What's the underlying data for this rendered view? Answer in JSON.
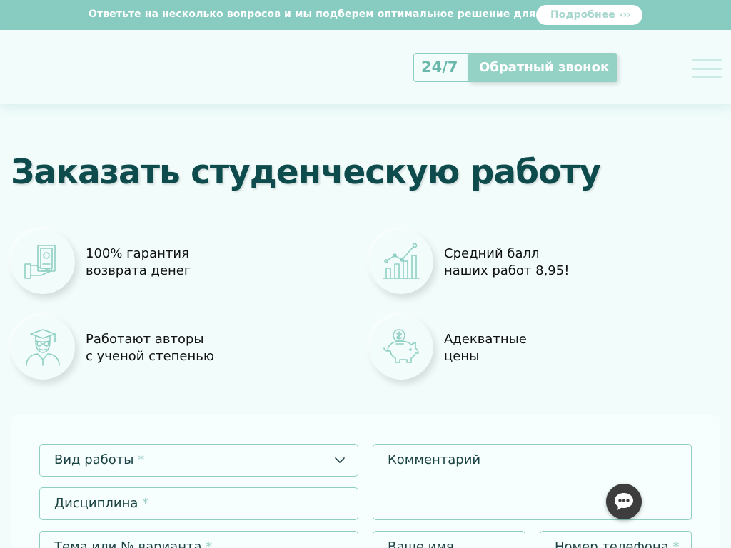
{
  "promo": {
    "text": "Ответьте на несколько вопросов и мы подберем оптимальное решение для Вас",
    "button_label": "Подробнее",
    "button_arrows": "›››"
  },
  "header": {
    "hours": "24/7",
    "callback_label": "Обратный звонок"
  },
  "main": {
    "title": "Заказать студенческую работу",
    "features": [
      {
        "icon": "money-hand-icon",
        "line1": "100% гарантия",
        "line2": "возврата денег"
      },
      {
        "icon": "growth-chart-icon",
        "line1": "Средний балл",
        "line2": "наших работ 8,95!"
      },
      {
        "icon": "graduate-author-icon",
        "line1": "Работают авторы",
        "line2": "с ученой степенью"
      },
      {
        "icon": "piggy-bank-icon",
        "line1": "Адекватные",
        "line2": "цены"
      }
    ]
  },
  "form": {
    "work_type": {
      "label": "Вид работы",
      "required_mark": "*"
    },
    "discipline": {
      "label": "Дисциплина",
      "required_mark": "*"
    },
    "topic": {
      "label": "Тема или № варианта",
      "required_mark": "*"
    },
    "comment": {
      "label": "Комментарий"
    },
    "name": {
      "label": "Ваше имя"
    },
    "phone": {
      "label": "Номер телефона",
      "required_mark": "*"
    }
  },
  "colors": {
    "accent": "#88ccc1",
    "title": "#0d4b4c",
    "background": "#f1fcfb",
    "chat": "#3d3d3d"
  }
}
